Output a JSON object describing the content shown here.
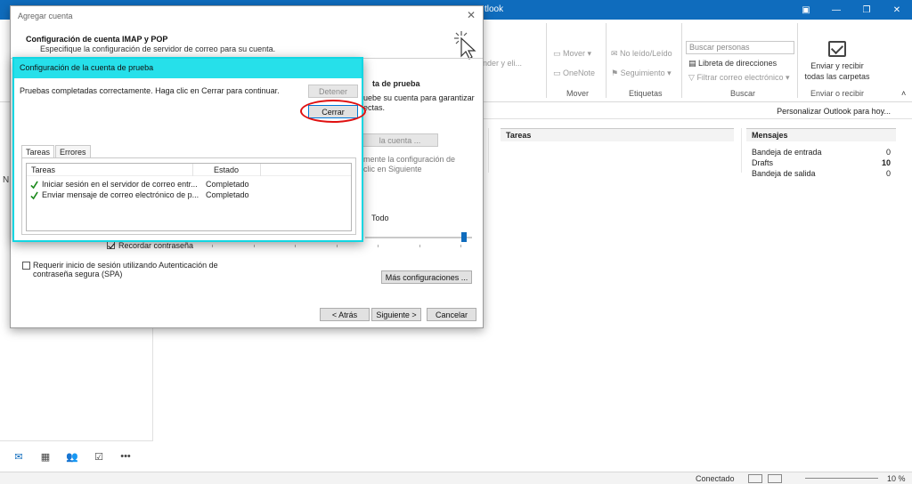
{
  "app": {
    "title_fragment": "tlook"
  },
  "window_controls": [
    "▣",
    "—",
    "❐",
    "✕"
  ],
  "ribbon": {
    "respond_fragment": "onder y eli...",
    "move_label": "Mover",
    "onenote_label": "OneNote",
    "move_group": "Mover",
    "unread_read": "No leído/Leído",
    "followup": "Seguimiento",
    "tags_group": "Etiquetas",
    "search_people_placeholder": "Buscar personas",
    "address_book": "Libreta de direcciones",
    "filter_email": "Filtrar correo electrónico",
    "search_group": "Buscar",
    "send_receive_all": "Enviar y recibir todas las carpetas",
    "send_receive_group": "Enviar o recibir"
  },
  "toolbar": {
    "customize": "Personalizar Outlook para hoy..."
  },
  "left_pane": {
    "letter": "N"
  },
  "tasks": {
    "header": "Tareas"
  },
  "messages": {
    "header": "Mensajes",
    "rows": [
      {
        "name": "Bandeja de entrada",
        "count": "0"
      },
      {
        "name": "Drafts",
        "count": "10"
      },
      {
        "name": "Bandeja de salida",
        "count": "0"
      }
    ]
  },
  "statusbar": {
    "connected": "Conectado",
    "zoom": "10 %"
  },
  "wizard": {
    "title": "Agregar cuenta",
    "heading": "Configuración de cuenta IMAP y POP",
    "subheading": "Especifique la configuración de servidor de correo para su cuenta.",
    "right_heading_fragment": "ta de prueba",
    "right_text_1": "uebe su cuenta para garantizar",
    "right_text_2": "ectas.",
    "test_button_fragment": "la cuenta ...",
    "auto_text_1": "mente la configuración de",
    "auto_text_2": "clic en Siguiente",
    "all_label": "Todo",
    "remember_password": "Recordar contraseña",
    "spa_line1": "Requerir inicio de sesión utilizando Autenticación de",
    "spa_line2": "contraseña segura (SPA)",
    "more_settings": "Más configuraciones ...",
    "back": "< Atrás",
    "next": "Siguiente >",
    "cancel": "Cancelar"
  },
  "test_dialog": {
    "title": "Configuración de la cuenta de prueba",
    "message": "Pruebas completadas correctamente. Haga clic en Cerrar para continuar.",
    "stop": "Detener",
    "close": "Cerrar",
    "tabs": [
      "Tareas",
      "Errores"
    ],
    "columns": [
      "Tareas",
      "Estado"
    ],
    "rows": [
      {
        "task": "Iniciar sesión en el servidor de correo entr...",
        "status": "Completado"
      },
      {
        "task": "Enviar mensaje de correo electrónico de p...",
        "status": "Completado"
      }
    ]
  },
  "colors": {
    "accent": "#0f6cbd",
    "dialog_title": "#26e0ea",
    "highlight_ring": "#e01010"
  }
}
